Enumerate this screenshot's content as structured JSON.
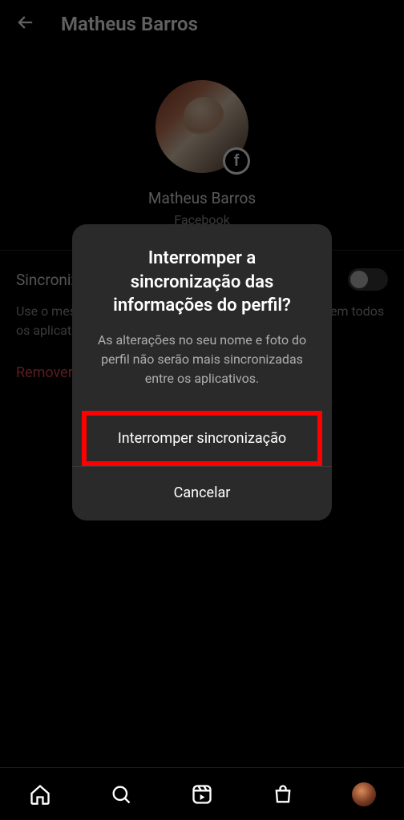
{
  "header": {
    "title": "Matheus Barros"
  },
  "profile": {
    "name": "Matheus Barros",
    "platform": "Facebook"
  },
  "settings": {
    "sync_label": "Sincronizar informações do perfil",
    "sync_on": false,
    "description": "Use o mesmo nome e foto do perfil de Matheus Barros em todos os aplicativos.",
    "remove_label": "Remover"
  },
  "modal": {
    "title": "Interromper a sincronização das informações do perfil?",
    "description": "As alterações no seu nome e foto do perfil não serão mais sincronizadas entre os aplicativos.",
    "primary_button": "Interromper sincronização",
    "cancel_button": "Cancelar"
  },
  "nav": {
    "items": [
      "home",
      "search",
      "reels",
      "shop",
      "profile"
    ]
  },
  "colors": {
    "danger": "#ed4956",
    "highlight": "#ff0000",
    "modal_bg": "#2a2a2a"
  }
}
